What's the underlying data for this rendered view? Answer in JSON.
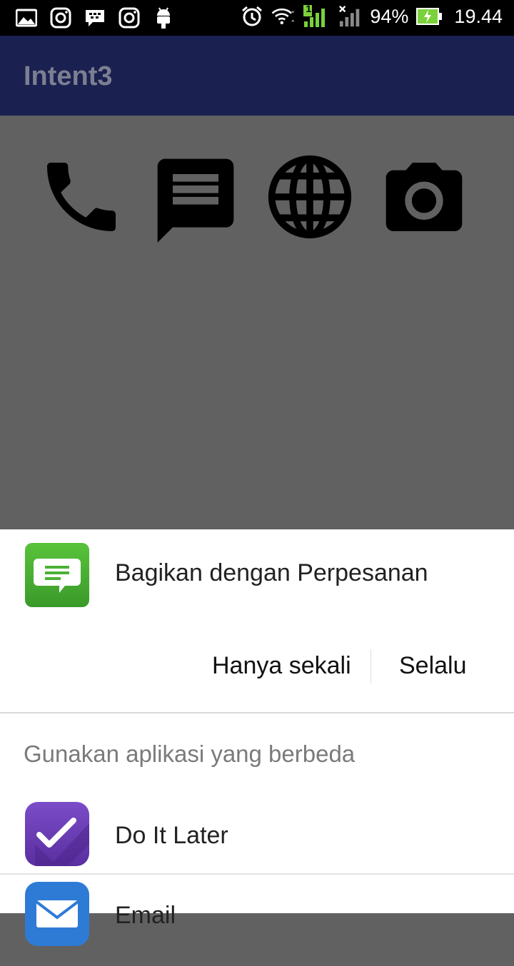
{
  "status_bar": {
    "battery": "94%",
    "time": "19.44",
    "signal_badge": "1",
    "icons": [
      "gallery-icon",
      "instagram-icon",
      "bbm-icon",
      "instagram-icon",
      "android-icon",
      "alarm-icon",
      "wifi-icon",
      "signal-icon",
      "signal-icon",
      "battery-charging-icon"
    ]
  },
  "app_bar": {
    "title": "Intent3"
  },
  "content": {
    "icons": [
      "phone-icon",
      "message-icon",
      "web-icon",
      "camera-icon"
    ]
  },
  "share_sheet": {
    "share_with": "Bagikan dengan Perpesanan",
    "just_once": "Hanya sekali",
    "always": "Selalu",
    "use_different_app": "Gunakan aplikasi yang berbeda",
    "apps": [
      {
        "label": "Do It Later",
        "icon": "do-it-later-icon",
        "color": "#6A3FB5"
      },
      {
        "label": "Email",
        "icon": "email-icon",
        "color": "#2E7BD6"
      }
    ]
  },
  "colors": {
    "app_bar": "#1A2050",
    "scrim": "#616161",
    "messaging_green": "#4BB236"
  }
}
